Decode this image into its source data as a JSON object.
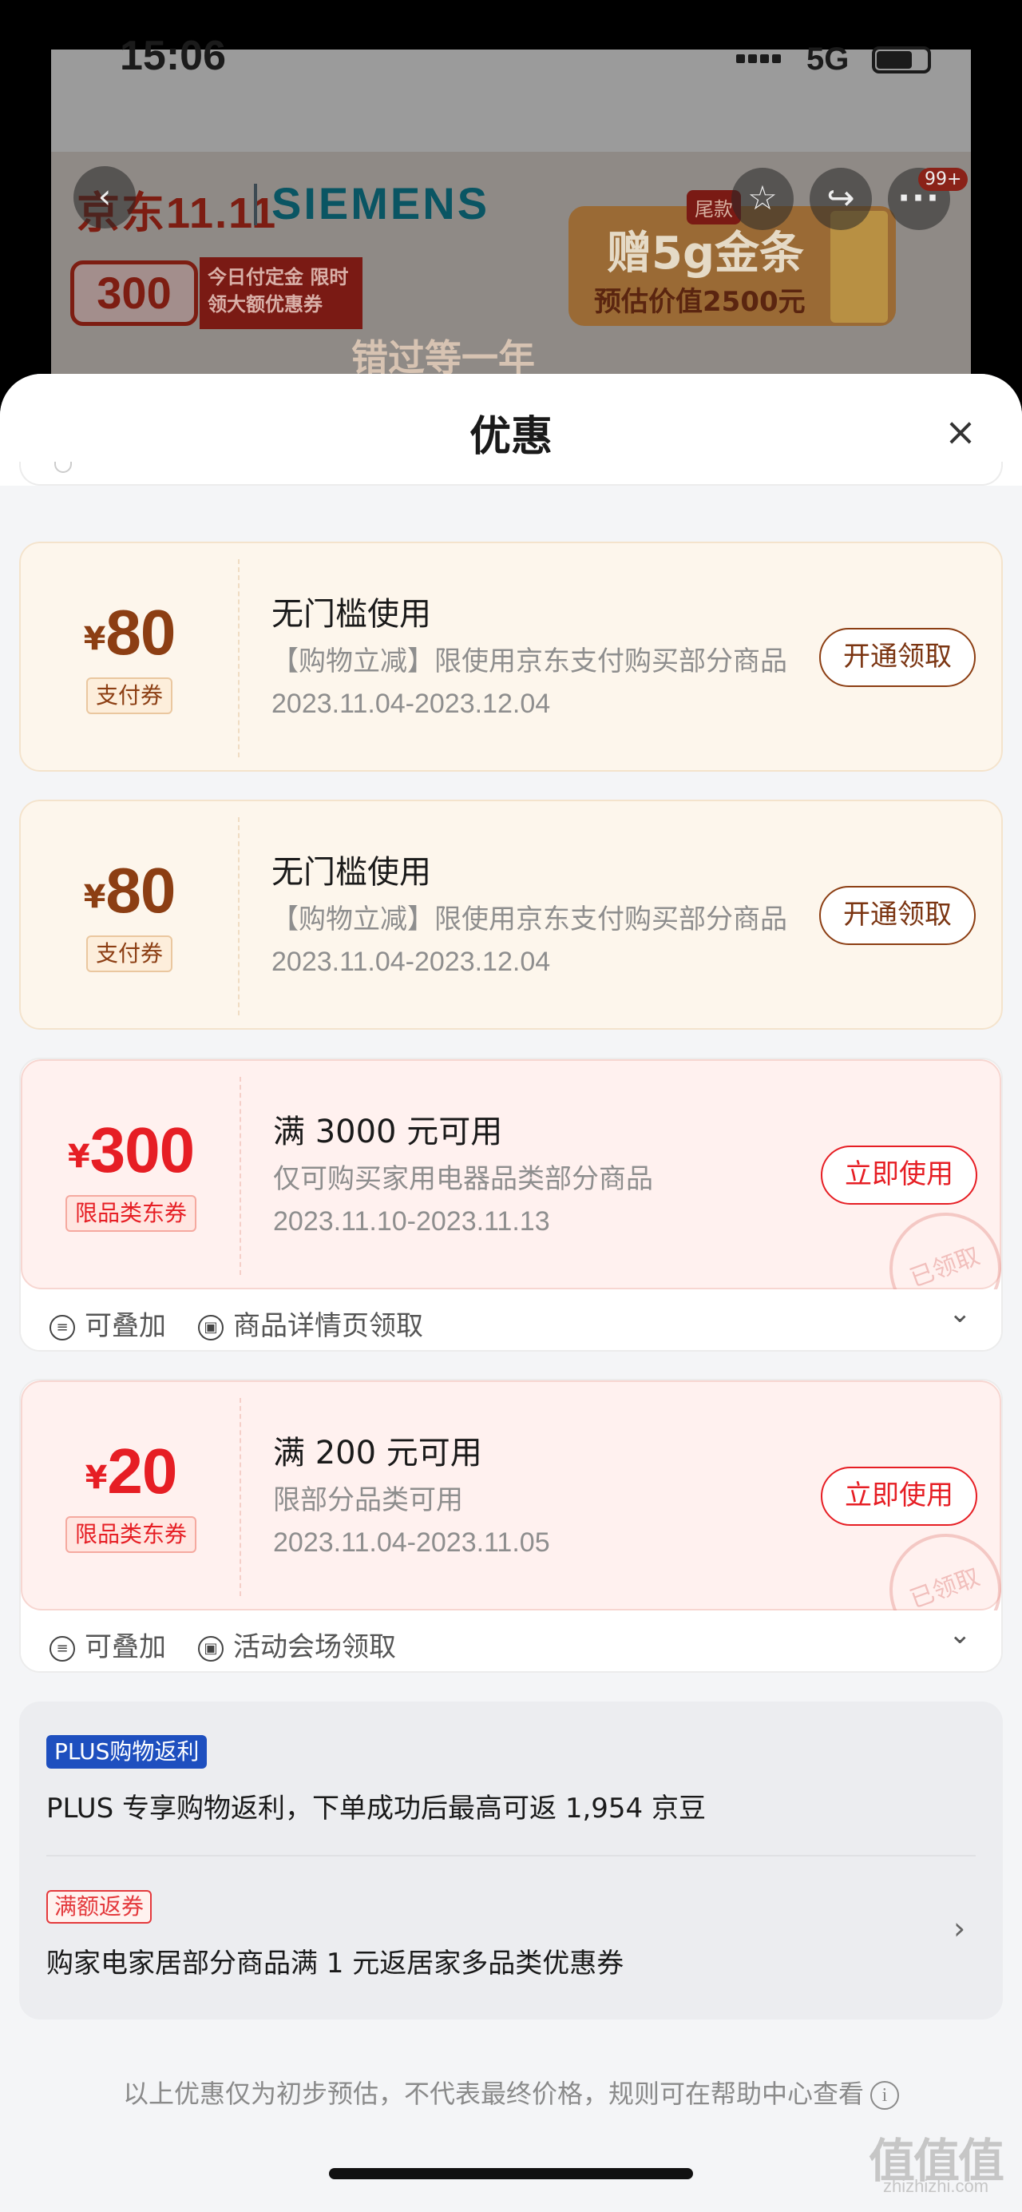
{
  "status_bar": {
    "time": "15:06",
    "network": "5G"
  },
  "background": {
    "brand_logo": "京东11.11",
    "brand_partner": "SIEMENS",
    "deposit_amount": "300",
    "deposit_text": "今日付定金 限时领大额优惠券",
    "gold_title": "赠5g金条",
    "gold_sub": "预估价值2500元",
    "bottom_text": "错过等一年",
    "sticker": "尾款",
    "notification_badge": "99+"
  },
  "sheet": {
    "title": "优惠",
    "close_label": "×"
  },
  "coupons": [
    {
      "currency": "¥",
      "amount": "80",
      "tag": "支付券",
      "title": "无门槛使用",
      "desc": "【购物立减】限使用京东支付购买部分商品",
      "date": "2023.11.04-2023.12.04",
      "button": "开通领取"
    },
    {
      "currency": "¥",
      "amount": "80",
      "tag": "支付券",
      "title": "无门槛使用",
      "desc": "【购物立减】限使用京东支付购买部分商品",
      "date": "2023.11.04-2023.12.04",
      "button": "开通领取"
    },
    {
      "currency": "¥",
      "amount": "300",
      "tag": "限品类东券",
      "title": "满 3000 元可用",
      "desc": "仅可购买家用电器品类部分商品",
      "date": "2023.11.10-2023.11.13",
      "button": "立即使用",
      "stamp": "已领取",
      "stackable": "可叠加",
      "source": "商品详情页领取"
    },
    {
      "currency": "¥",
      "amount": "20",
      "tag": "限品类东券",
      "title": "满 200 元可用",
      "desc": "限部分品类可用",
      "date": "2023.11.04-2023.11.05",
      "button": "立即使用",
      "stamp": "已领取",
      "stackable": "可叠加",
      "source": "活动会场领取"
    }
  ],
  "perks": {
    "plus_tag": "PLUS购物返利",
    "plus_text": "PLUS 专享购物返利，下单成功后最高可返 1,954 京豆",
    "full_tag": "满额返券",
    "full_text": "购家电家居部分商品满 1 元返居家多品类优惠券"
  },
  "footnote": "以上优惠仅为初步预估，不代表最终价格，规则可在帮助中心查看",
  "watermark": {
    "main": "值值值",
    "sub": "zhizhizhi.com"
  },
  "colors": {
    "gold_accent": "#8c3e13",
    "red_accent": "#e61e24",
    "plus_blue": "#1e4fbf"
  }
}
